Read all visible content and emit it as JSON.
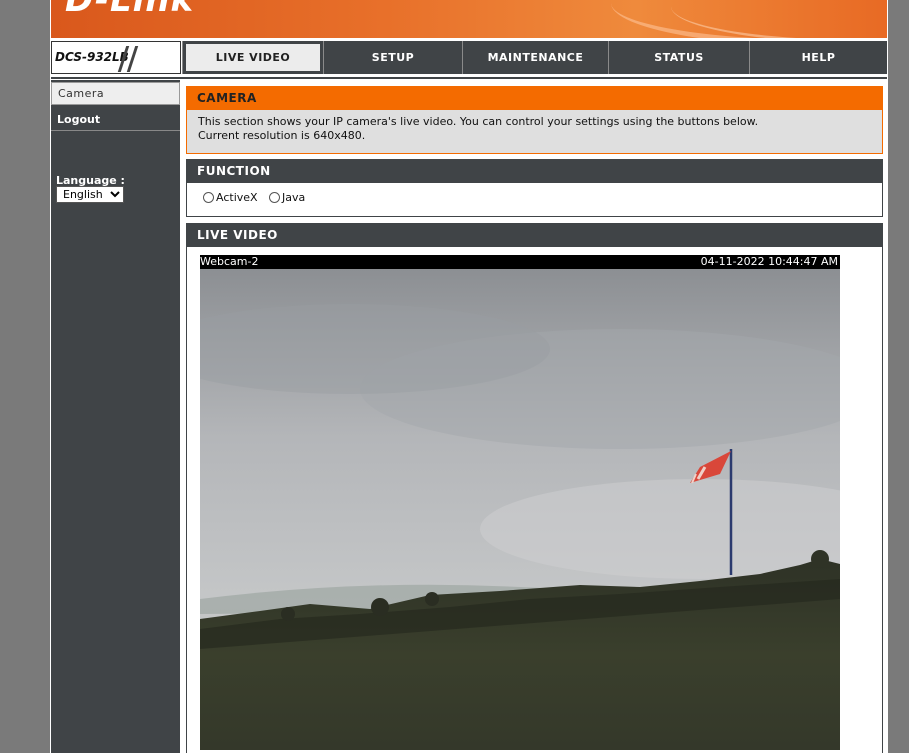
{
  "brand": {
    "logo": "D-Link",
    "model": "DCS-932LB"
  },
  "nav": {
    "tabs": [
      {
        "label": "LIVE VIDEO",
        "active": true
      },
      {
        "label": "SETUP"
      },
      {
        "label": "MAINTENANCE"
      },
      {
        "label": "STATUS"
      },
      {
        "label": "HELP"
      }
    ]
  },
  "sidebar": {
    "items": [
      {
        "label": "Camera",
        "current": true
      },
      {
        "label": "Logout"
      }
    ],
    "language_label": "Language :",
    "language_selected": "English"
  },
  "camera_panel": {
    "title": "CAMERA",
    "line1": "This section shows your IP camera's live video. You can control your settings using the buttons below.",
    "line2": "Current resolution is 640x480."
  },
  "function_panel": {
    "title": "FUNCTION",
    "options": [
      {
        "label": "ActiveX",
        "checked": false
      },
      {
        "label": "Java",
        "checked": false
      }
    ]
  },
  "live_video_panel": {
    "title": "LIVE VIDEO",
    "camera_name": "Webcam-2",
    "timestamp": "04-11-2022 10:44:47 AM"
  },
  "colors": {
    "accent_orange": "#f46b00",
    "nav_dark": "#404447",
    "page_bg": "#7a7a7a"
  }
}
